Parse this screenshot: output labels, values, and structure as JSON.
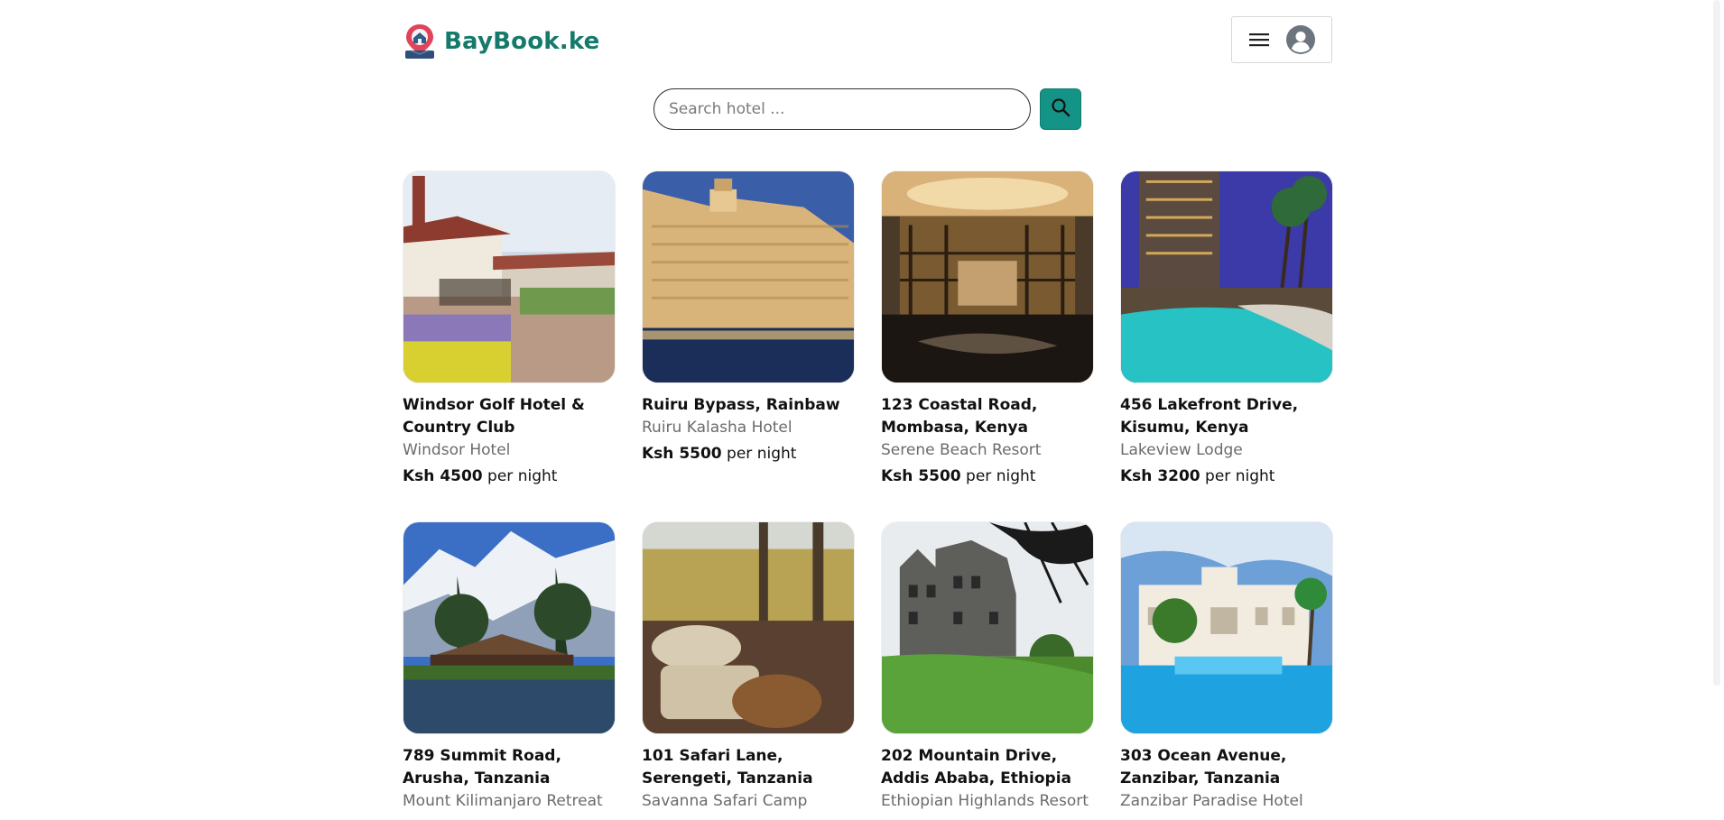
{
  "brand": {
    "name": "BayBook.ke",
    "logo_icon": "map-pin-house-icon",
    "color": "#157a6a"
  },
  "header": {
    "menu_icon": "hamburger-icon",
    "avatar_icon": "user-avatar-icon"
  },
  "search": {
    "placeholder": "Search hotel ...",
    "value": "",
    "button_icon": "search-icon",
    "button_color": "#149486"
  },
  "listings": [
    {
      "address": "Windsor Golf Hotel & Country Club",
      "hotel": "Windsor Hotel",
      "price": "Ksh 4500",
      "unit": "per night"
    },
    {
      "address": "Ruiru Bypass, Rainbaw",
      "hotel": "Ruiru Kalasha Hotel",
      "price": "Ksh 5500",
      "unit": "per night"
    },
    {
      "address": "123 Coastal Road, Mombasa, Kenya",
      "hotel": "Serene Beach Resort",
      "price": "Ksh 5500",
      "unit": "per night"
    },
    {
      "address": "456 Lakefront Drive, Kisumu, Kenya",
      "hotel": "Lakeview Lodge",
      "price": "Ksh 3200",
      "unit": "per night"
    },
    {
      "address": "789 Summit Road, Arusha, Tanzania",
      "hotel": "Mount Kilimanjaro Retreat"
    },
    {
      "address": "101 Safari Lane, Serengeti, Tanzania",
      "hotel": "Savanna Safari Camp"
    },
    {
      "address": "202 Mountain Drive, Addis Ababa, Ethiopia",
      "hotel": "Ethiopian Highlands Resort"
    },
    {
      "address": "303 Ocean Avenue, Zanzibar, Tanzania",
      "hotel": "Zanzibar Paradise Hotel"
    }
  ]
}
